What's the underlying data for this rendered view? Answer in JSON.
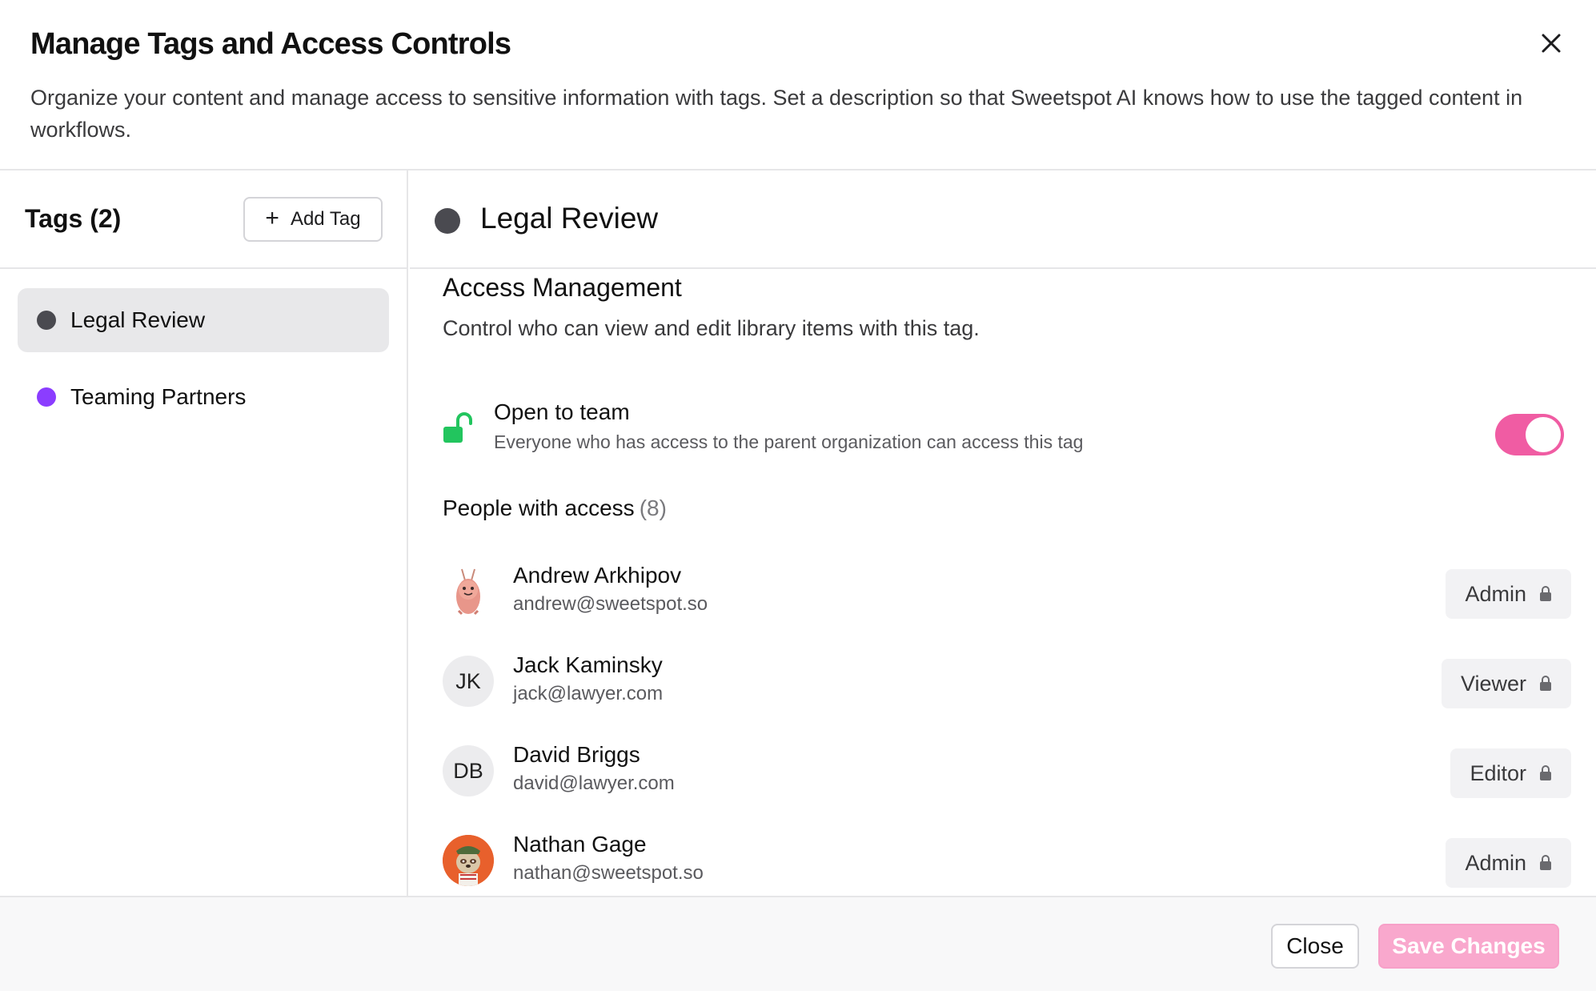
{
  "header": {
    "title": "Manage Tags and Access Controls",
    "subtitle": "Organize your content and manage access to sensitive information with tags. Set a description so that Sweetspot AI knows how to use the tagged content in workflows.",
    "close_icon": "close-icon"
  },
  "sidebar": {
    "title": "Tags (2)",
    "add_tag_label": "Add Tag",
    "tags": [
      {
        "label": "Legal Review",
        "color": "#4a4a50",
        "active": true
      },
      {
        "label": "Teaming Partners",
        "color": "#8b3dff",
        "active": false
      }
    ]
  },
  "main": {
    "tag_name": "Legal Review",
    "tag_color": "#4a4a50",
    "access_title": "Access Management",
    "access_desc": "Control who can view and edit library items with this tag.",
    "open_team": {
      "title": "Open to team",
      "desc": "Everyone who has access to the parent organization can access this tag",
      "enabled": true,
      "icon": "unlocked-icon",
      "icon_color": "#22c55e"
    },
    "people_title": "People with access",
    "people_count": "(8)",
    "people": [
      {
        "name": "Andrew Arkhipov",
        "email": "andrew@sweetspot.so",
        "role": "Admin",
        "initials": "",
        "avatar": "shrimp-avatar"
      },
      {
        "name": "Jack Kaminsky",
        "email": "jack@lawyer.com",
        "role": "Viewer",
        "initials": "JK",
        "avatar": ""
      },
      {
        "name": "David Briggs",
        "email": "david@lawyer.com",
        "role": "Editor",
        "initials": "DB",
        "avatar": ""
      },
      {
        "name": "Nathan Gage",
        "email": "nathan@sweetspot.so",
        "role": "Admin",
        "initials": "",
        "avatar": "sloth-avatar"
      }
    ]
  },
  "footer": {
    "close_label": "Close",
    "save_label": "Save Changes"
  },
  "colors": {
    "accent": "#f05ca3",
    "save_disabled": "#f9a8cd"
  }
}
